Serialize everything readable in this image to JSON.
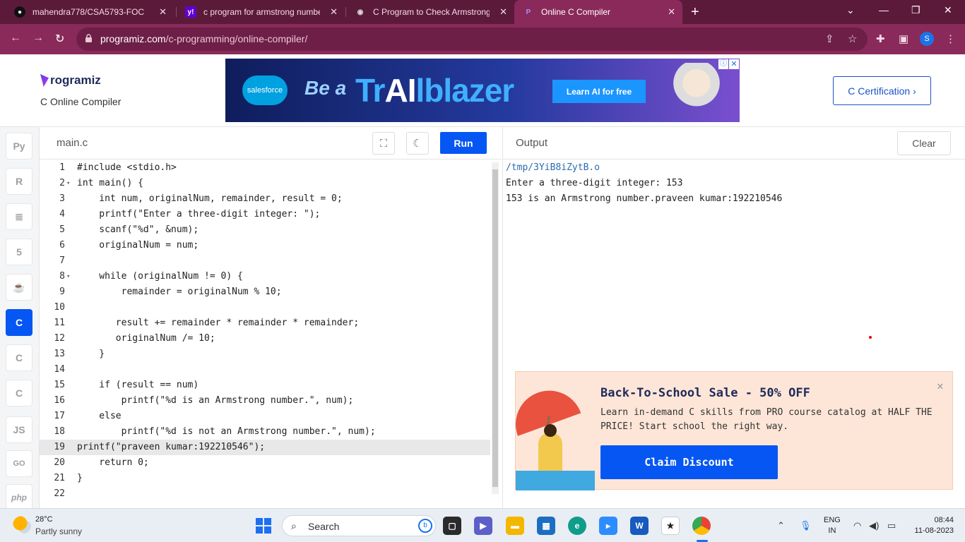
{
  "browser": {
    "tabs": [
      {
        "title": "mahendra778/CSA5793-FOC",
        "icon": "github-icon"
      },
      {
        "title": "c program for armstrong numbe",
        "icon": "yahoo-icon"
      },
      {
        "title": "C Program to Check Armstrong N",
        "icon": "web-icon"
      },
      {
        "title": "Online C Compiler",
        "icon": "programiz-icon",
        "active": true
      }
    ],
    "url_host": "programiz.com",
    "url_path": "/c-programming/online-compiler/",
    "profile_initial": "S"
  },
  "site": {
    "logo_text": "rogramiz",
    "subtitle": "C Online Compiler",
    "certification_button": "C Certification ›",
    "ad": {
      "brand": "salesforce",
      "headline_be": "Be a",
      "headline_trail_1": "Tr",
      "headline_ai": "AI",
      "headline_trail_2": "lblazer",
      "cta": "Learn AI for free"
    }
  },
  "sidebar": {
    "languages": [
      {
        "name": "python",
        "glyph": "Py"
      },
      {
        "name": "r",
        "glyph": "R"
      },
      {
        "name": "sql",
        "glyph": "≣"
      },
      {
        "name": "html",
        "glyph": "5"
      },
      {
        "name": "java",
        "glyph": "☕"
      },
      {
        "name": "c",
        "glyph": "C",
        "active": true
      },
      {
        "name": "cpp",
        "glyph": "C"
      },
      {
        "name": "csharp",
        "glyph": "C"
      },
      {
        "name": "javascript",
        "glyph": "JS"
      },
      {
        "name": "go",
        "glyph": "GO"
      },
      {
        "name": "php",
        "glyph": "php"
      }
    ]
  },
  "editor": {
    "filename": "main.c",
    "run_label": "Run",
    "active_line": 19,
    "lines": [
      "#include <stdio.h>",
      "int main() {",
      "    int num, originalNum, remainder, result = 0;",
      "    printf(\"Enter a three-digit integer: \");",
      "    scanf(\"%d\", &num);",
      "    originalNum = num;",
      "",
      "    while (originalNum != 0) {",
      "        remainder = originalNum % 10;",
      "",
      "       result += remainder * remainder * remainder;",
      "       originalNum /= 10;",
      "    }",
      "",
      "    if (result == num)",
      "        printf(\"%d is an Armstrong number.\", num);",
      "    else",
      "        printf(\"%d is not an Armstrong number.\", num);",
      "printf(\"praveen kumar:192210546\");",
      "    return 0;",
      "}",
      ""
    ]
  },
  "output": {
    "label": "Output",
    "clear_label": "Clear",
    "lines": [
      "/tmp/3YiB8iZytB.o",
      "Enter a three-digit integer: 153",
      "153 is an Armstrong number.praveen kumar:192210546"
    ]
  },
  "promo": {
    "title": "Back-To-School Sale - 50% OFF",
    "text": "Learn in-demand C skills from PRO course catalog at HALF THE PRICE! Start school the right way.",
    "button": "Claim Discount"
  },
  "taskbar": {
    "temperature": "28°C",
    "condition": "Partly sunny",
    "search_label": "Search",
    "lang_line1": "ENG",
    "lang_line2": "IN",
    "time": "08:44",
    "date": "11-08-2023"
  },
  "colors": {
    "chrome_dark": "#5c1a3b",
    "chrome_toolbar": "#8a2a5a",
    "accent_blue": "#0556f3"
  }
}
